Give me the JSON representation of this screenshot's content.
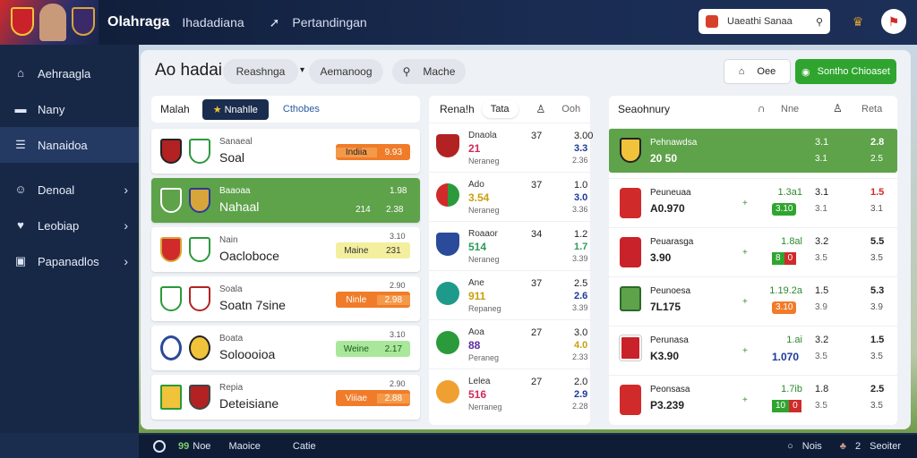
{
  "topbar": {
    "app_title": "Olahraga",
    "tab1": "Ihadadiana",
    "tab2_icon": "arrow-icon",
    "tab2": "Pertandingan",
    "search_text": "Uaeathi Sanaa"
  },
  "sidebar": {
    "items": [
      {
        "label": "Aehraagla",
        "icon": "home-icon"
      },
      {
        "label": "Nany",
        "icon": "bed-icon"
      },
      {
        "label": "Nanaidoa",
        "icon": "list-icon"
      },
      {
        "label": "Denoal",
        "icon": "user-icon"
      },
      {
        "label": "Leobiap",
        "icon": "heart-icon"
      },
      {
        "label": "Papanadlos",
        "icon": "image-icon"
      }
    ]
  },
  "toolbar": {
    "title": "Ao hadai",
    "filter1": "Reashnga",
    "filter2": "Aemanoog",
    "filter3": "Mache",
    "btn_white": "Oee",
    "btn_green": "Sontho Chioaset"
  },
  "left_col": {
    "header1": "Malah",
    "tab_active": "Nnahlle",
    "tab2": "Cthobes",
    "cards": [
      {
        "label": "Sanaeal",
        "name": "Soal",
        "odd_a": "Indiia",
        "odd_b": "9.93",
        "color": "#f07c2a"
      },
      {
        "label": "Baaoaa",
        "name": "Nahaal",
        "val_top": "1.98",
        "val_a": "214",
        "val_b": "2.38",
        "highlight": true
      },
      {
        "label": "Nain",
        "name": "Oacloboce",
        "val_top": "3.10",
        "odd_a": "Maine",
        "odd_b": "231",
        "color": "#f3ef9e"
      },
      {
        "label": "Soala",
        "name": "Soatn 7sine",
        "val_top": "2.90",
        "odd_a": "Ninle",
        "odd_b": "2.98",
        "color": "#f07c2a"
      },
      {
        "label": "Boata",
        "name": "Soloooioa",
        "val_top": "3.10",
        "odd_a": "Weine",
        "odd_b": "2.17",
        "color": "#a9e89a"
      },
      {
        "label": "Repia",
        "name": "Deteisiane",
        "val_top": "2.90",
        "odd_a": "Viiiae",
        "odd_b": "2.88",
        "color": "#f07c2a"
      }
    ]
  },
  "mid_col": {
    "header1": "Rena!h",
    "header_tab": "Tata",
    "header2": "Ooh",
    "rows": [
      {
        "t1": "Dnaola",
        "t2": "21",
        "t3": "Neraneg",
        "n": "37",
        "a": "3.00",
        "b": "3.3",
        "c": "2.36",
        "t2color": "#d02a5a",
        "bcolor": "#1a3a9a"
      },
      {
        "t1": "Ado",
        "t2": "3.54",
        "t3": "Neraneg",
        "n": "37",
        "a": "1.0",
        "b": "3.0",
        "c": "3.36",
        "t2color": "#c9a010",
        "bcolor": "#1a3a9a"
      },
      {
        "t1": "Roaaor",
        "t2": "514",
        "t3": "Neraneg",
        "n": "34",
        "a": "1.2",
        "b": "1.7",
        "c": "3.39",
        "t2color": "#2c9a5a",
        "bcolor": "#2c9a5a"
      },
      {
        "t1": "Ane",
        "t2": "911",
        "t3": "Repaneg",
        "n": "37",
        "a": "2.5",
        "b": "2.6",
        "c": "3.39",
        "t2color": "#c9a010",
        "bcolor": "#1a3a9a"
      },
      {
        "t1": "Aoa",
        "t2": "88",
        "t3": "Peraneg",
        "n": "27",
        "a": "3.0",
        "b": "4.0",
        "c": "2.33",
        "t2color": "#5a2aa0",
        "bcolor": "#c9a010"
      },
      {
        "t1": "Lelea",
        "t2": "516",
        "t3": "Nerraneg",
        "n": "27",
        "a": "2.0",
        "b": "2.9",
        "c": "2.28",
        "t2color": "#d02a5a",
        "bcolor": "#1a3a9a"
      }
    ]
  },
  "right_col": {
    "header1": "Seaohnury",
    "header2": "Nne",
    "header3": "Reta",
    "rows": [
      {
        "r1": "Pehnawdsa",
        "r2": "20 50",
        "v1": "",
        "c1": "3.1",
        "c2": "3.1",
        "d1": "2.8",
        "d2": "2.5",
        "highlight": true
      },
      {
        "r1": "Peuneuaa",
        "r2": "A0.970",
        "v1": "1.3a1",
        "b1": "3.10",
        "b2": "",
        "c1": "3.1",
        "c2": "3.1",
        "d1": "1.5",
        "d2": "3.1",
        "d1color": "#d02a2a"
      },
      {
        "r1": "Peuarasga",
        "r2": "3.90",
        "v1": "1.8al",
        "b1": "8",
        "b2": "0",
        "c1": "3.2",
        "c2": "3.5",
        "d1": "5.5",
        "d2": "3.5"
      },
      {
        "r1": "Peunoesa",
        "r2": "7L175",
        "v1": "1.19.2a",
        "b1": "3.10",
        "b2": "",
        "c1": "1.5",
        "c2": "3.9",
        "d1": "5.3",
        "d2": "3.9"
      },
      {
        "r1": "Perunasa",
        "r2": "K3.90",
        "v1": "1.ai",
        "v1b": "1.070",
        "c1": "3.2",
        "c2": "3.5",
        "d1": "1.5",
        "d2": "3.5"
      },
      {
        "r1": "Peonsasa",
        "r2": "P3.239",
        "v1": "1.7ib",
        "b1": "10",
        "b2": "0",
        "c1": "1.8",
        "c2": "3.5",
        "d1": "2.5",
        "d2": "3.5"
      }
    ]
  },
  "bottombar": {
    "item1_green": "99",
    "item1": "Noe",
    "item2": "Maoice",
    "item3": "Catie",
    "item4": "Nois",
    "item5_num": "2",
    "item5": "Seoiter"
  }
}
